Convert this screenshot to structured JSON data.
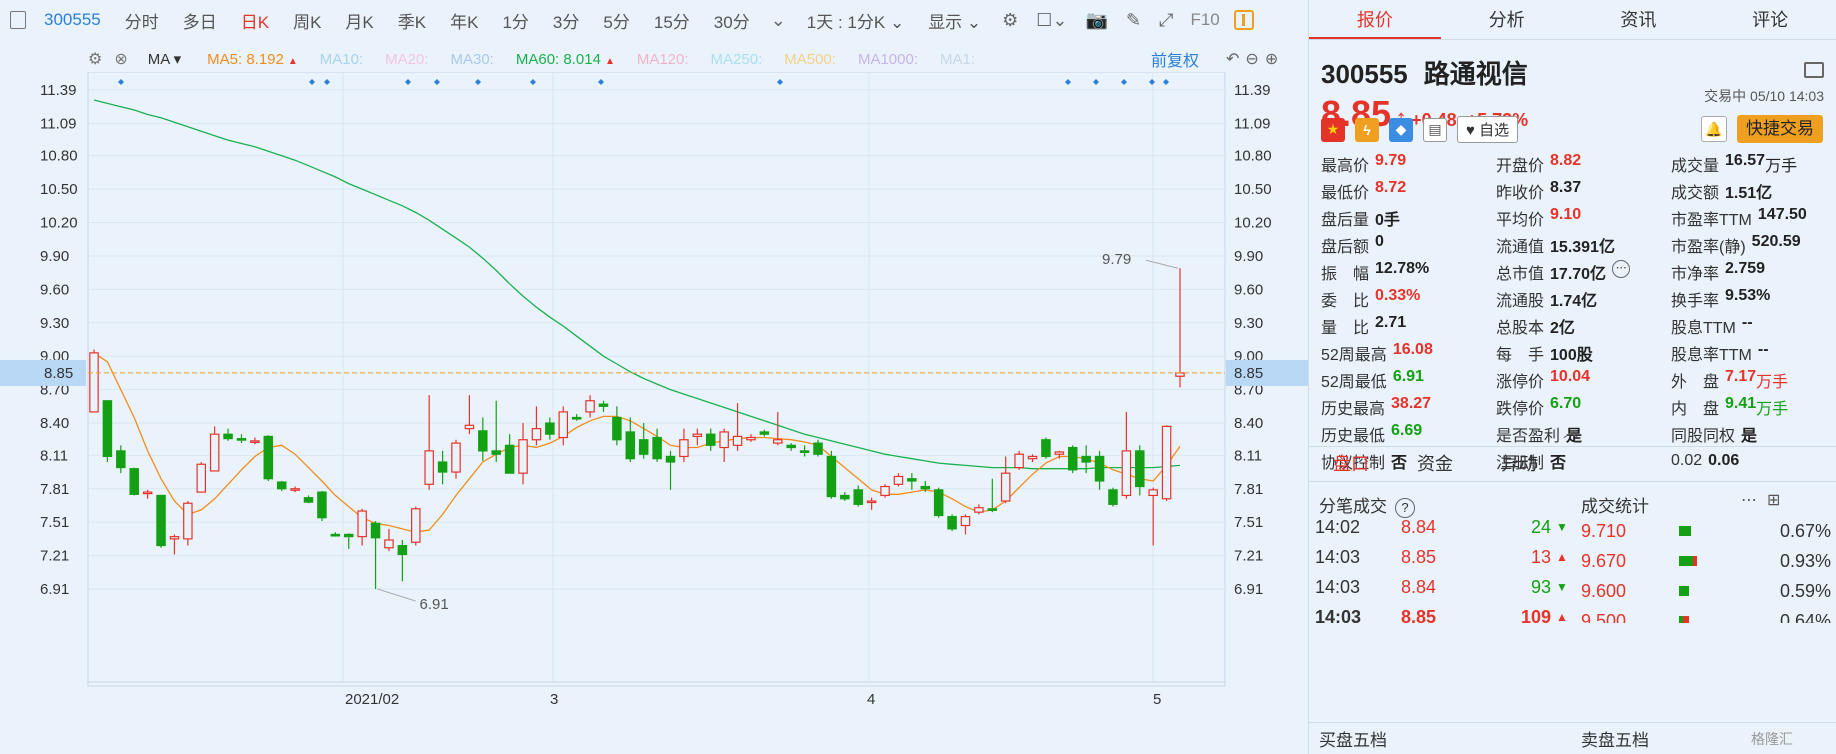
{
  "toolbar": {
    "code": "300555",
    "items": [
      "分时",
      "多日",
      "日K",
      "周K",
      "月K",
      "季K",
      "年K",
      "1分",
      "3分",
      "5分",
      "15分",
      "30分"
    ],
    "active": "日K",
    "period_select": "1天 : 1分K",
    "display_select": "显示",
    "f10": "F10"
  },
  "ma_bar": {
    "indicator": "MA",
    "items": [
      {
        "label": "MA5:",
        "value": "8.192",
        "color": "#f08c1e",
        "arrow": "up"
      },
      {
        "label": "MA10:",
        "value": "",
        "color": "#a8d4f0"
      },
      {
        "label": "MA20:",
        "value": "",
        "color": "#f2c6e0"
      },
      {
        "label": "MA30:",
        "value": "",
        "color": "#a8c8f0"
      },
      {
        "label": "MA60:",
        "value": "8.014",
        "color": "#1ab04e",
        "arrow": "up"
      },
      {
        "label": "MA120:",
        "value": "",
        "color": "#f0b4c8"
      },
      {
        "label": "MA250:",
        "value": "",
        "color": "#a8e0f0"
      },
      {
        "label": "MA500:",
        "value": "",
        "color": "#f5d08a"
      },
      {
        "label": "MA1000:",
        "value": "",
        "color": "#c8b4e8"
      },
      {
        "label": "MA1:",
        "value": "",
        "color": "#c8d8e8"
      }
    ],
    "fuquan": "前复权"
  },
  "chart_data": {
    "type": "candlestick",
    "y_ticks": [
      "11.39",
      "11.09",
      "10.80",
      "10.50",
      "10.20",
      "9.90",
      "9.60",
      "9.30",
      "9.00",
      "8.70",
      "8.40",
      "8.11",
      "7.81",
      "7.51",
      "7.21",
      "6.91"
    ],
    "ylim": [
      6.91,
      11.39
    ],
    "x_labels": [
      "2021/02",
      "3",
      "4",
      "5"
    ],
    "current_price": "8.85",
    "high_marker": "9.79",
    "low_marker": "6.91",
    "colors": {
      "up": "#e6332a",
      "down": "#14a014",
      "ma5": "#f08c1e",
      "ma60": "#1ab04e"
    },
    "candles": [
      {
        "o": 8.5,
        "h": 9.06,
        "l": 8.5,
        "c": 9.03
      },
      {
        "o": 8.6,
        "h": 8.6,
        "l": 8.05,
        "c": 8.1
      },
      {
        "o": 8.15,
        "h": 8.2,
        "l": 7.95,
        "c": 8.0
      },
      {
        "o": 7.99,
        "h": 8.0,
        "l": 7.75,
        "c": 7.76
      },
      {
        "o": 7.77,
        "h": 7.8,
        "l": 7.72,
        "c": 7.78
      },
      {
        "o": 7.75,
        "h": 7.75,
        "l": 7.28,
        "c": 7.3
      },
      {
        "o": 7.36,
        "h": 7.4,
        "l": 7.22,
        "c": 7.38
      },
      {
        "o": 7.36,
        "h": 7.7,
        "l": 7.3,
        "c": 7.68
      },
      {
        "o": 7.78,
        "h": 8.05,
        "l": 7.78,
        "c": 8.03
      },
      {
        "o": 7.97,
        "h": 8.37,
        "l": 7.97,
        "c": 8.3
      },
      {
        "o": 8.3,
        "h": 8.35,
        "l": 8.24,
        "c": 8.26
      },
      {
        "o": 8.26,
        "h": 8.3,
        "l": 8.22,
        "c": 8.25
      },
      {
        "o": 8.24,
        "h": 8.27,
        "l": 8.21,
        "c": 8.24
      },
      {
        "o": 8.28,
        "h": 8.29,
        "l": 7.88,
        "c": 7.9
      },
      {
        "o": 7.87,
        "h": 7.88,
        "l": 7.79,
        "c": 7.81
      },
      {
        "o": 7.8,
        "h": 7.83,
        "l": 7.78,
        "c": 7.81
      },
      {
        "o": 7.73,
        "h": 7.75,
        "l": 7.68,
        "c": 7.69
      },
      {
        "o": 7.78,
        "h": 7.79,
        "l": 7.52,
        "c": 7.55
      },
      {
        "o": 7.4,
        "h": 7.42,
        "l": 7.38,
        "c": 7.39
      },
      {
        "o": 7.4,
        "h": 7.41,
        "l": 7.27,
        "c": 7.38
      },
      {
        "o": 7.38,
        "h": 7.63,
        "l": 7.3,
        "c": 7.61
      },
      {
        "o": 7.5,
        "h": 7.52,
        "l": 6.91,
        "c": 7.37
      },
      {
        "o": 7.28,
        "h": 7.45,
        "l": 7.25,
        "c": 7.35
      },
      {
        "o": 7.3,
        "h": 7.35,
        "l": 6.98,
        "c": 7.22
      },
      {
        "o": 7.33,
        "h": 7.65,
        "l": 7.3,
        "c": 7.63
      },
      {
        "o": 7.85,
        "h": 8.65,
        "l": 7.8,
        "c": 8.15
      },
      {
        "o": 8.05,
        "h": 8.15,
        "l": 7.85,
        "c": 7.96
      },
      {
        "o": 7.96,
        "h": 8.25,
        "l": 7.9,
        "c": 8.22
      },
      {
        "o": 8.35,
        "h": 8.65,
        "l": 8.3,
        "c": 8.38
      },
      {
        "o": 8.33,
        "h": 8.45,
        "l": 8.06,
        "c": 8.15
      },
      {
        "o": 8.15,
        "h": 8.6,
        "l": 8.05,
        "c": 8.12
      },
      {
        "o": 8.2,
        "h": 8.3,
        "l": 7.95,
        "c": 7.95
      },
      {
        "o": 7.95,
        "h": 8.4,
        "l": 7.85,
        "c": 8.25
      },
      {
        "o": 8.25,
        "h": 8.55,
        "l": 8.2,
        "c": 8.35
      },
      {
        "o": 8.4,
        "h": 8.45,
        "l": 8.25,
        "c": 8.3
      },
      {
        "o": 8.27,
        "h": 8.55,
        "l": 8.2,
        "c": 8.5
      },
      {
        "o": 8.45,
        "h": 8.48,
        "l": 8.42,
        "c": 8.44
      },
      {
        "o": 8.5,
        "h": 8.65,
        "l": 8.45,
        "c": 8.6
      },
      {
        "o": 8.57,
        "h": 8.6,
        "l": 8.5,
        "c": 8.55
      },
      {
        "o": 8.45,
        "h": 8.55,
        "l": 8.2,
        "c": 8.25
      },
      {
        "o": 8.32,
        "h": 8.45,
        "l": 8.05,
        "c": 8.08
      },
      {
        "o": 8.25,
        "h": 8.4,
        "l": 8.08,
        "c": 8.12
      },
      {
        "o": 8.27,
        "h": 8.35,
        "l": 8.05,
        "c": 8.08
      },
      {
        "o": 8.1,
        "h": 8.15,
        "l": 7.8,
        "c": 8.05
      },
      {
        "o": 8.1,
        "h": 8.35,
        "l": 8.05,
        "c": 8.25
      },
      {
        "o": 8.28,
        "h": 8.35,
        "l": 8.2,
        "c": 8.3
      },
      {
        "o": 8.3,
        "h": 8.35,
        "l": 8.15,
        "c": 8.2
      },
      {
        "o": 8.18,
        "h": 8.35,
        "l": 8.05,
        "c": 8.32
      },
      {
        "o": 8.2,
        "h": 8.58,
        "l": 8.15,
        "c": 8.28
      },
      {
        "o": 8.25,
        "h": 8.3,
        "l": 8.23,
        "c": 8.27
      },
      {
        "o": 8.32,
        "h": 8.34,
        "l": 8.28,
        "c": 8.3
      },
      {
        "o": 8.22,
        "h": 8.5,
        "l": 8.2,
        "c": 8.25
      },
      {
        "o": 8.2,
        "h": 8.22,
        "l": 8.15,
        "c": 8.18
      },
      {
        "o": 8.15,
        "h": 8.2,
        "l": 8.1,
        "c": 8.14
      },
      {
        "o": 8.22,
        "h": 8.25,
        "l": 8.1,
        "c": 8.12
      },
      {
        "o": 8.1,
        "h": 8.15,
        "l": 7.72,
        "c": 7.74
      },
      {
        "o": 7.75,
        "h": 7.78,
        "l": 7.7,
        "c": 7.72
      },
      {
        "o": 7.8,
        "h": 7.84,
        "l": 7.65,
        "c": 7.67
      },
      {
        "o": 7.7,
        "h": 7.73,
        "l": 7.62,
        "c": 7.7
      },
      {
        "o": 7.75,
        "h": 7.85,
        "l": 7.73,
        "c": 7.83
      },
      {
        "o": 7.85,
        "h": 7.95,
        "l": 7.83,
        "c": 7.92
      },
      {
        "o": 7.9,
        "h": 7.95,
        "l": 7.8,
        "c": 7.88
      },
      {
        "o": 7.83,
        "h": 7.88,
        "l": 7.78,
        "c": 7.81
      },
      {
        "o": 7.8,
        "h": 7.82,
        "l": 7.55,
        "c": 7.57
      },
      {
        "o": 7.56,
        "h": 7.58,
        "l": 7.43,
        "c": 7.45
      },
      {
        "o": 7.48,
        "h": 7.58,
        "l": 7.4,
        "c": 7.56
      },
      {
        "o": 7.6,
        "h": 7.67,
        "l": 7.58,
        "c": 7.64
      },
      {
        "o": 7.63,
        "h": 7.9,
        "l": 7.6,
        "c": 7.62
      },
      {
        "o": 7.7,
        "h": 8.1,
        "l": 7.68,
        "c": 7.95
      },
      {
        "o": 8.0,
        "h": 8.15,
        "l": 7.98,
        "c": 8.12
      },
      {
        "o": 8.08,
        "h": 8.12,
        "l": 8.05,
        "c": 8.1
      },
      {
        "o": 8.25,
        "h": 8.27,
        "l": 8.08,
        "c": 8.1
      },
      {
        "o": 8.12,
        "h": 8.15,
        "l": 8.08,
        "c": 8.14
      },
      {
        "o": 8.18,
        "h": 8.2,
        "l": 7.95,
        "c": 7.98
      },
      {
        "o": 8.1,
        "h": 8.2,
        "l": 7.95,
        "c": 8.05
      },
      {
        "o": 8.1,
        "h": 8.15,
        "l": 7.8,
        "c": 7.88
      },
      {
        "o": 7.8,
        "h": 7.82,
        "l": 7.65,
        "c": 7.67
      },
      {
        "o": 7.75,
        "h": 8.5,
        "l": 7.72,
        "c": 8.15
      },
      {
        "o": 8.15,
        "h": 8.2,
        "l": 7.75,
        "c": 7.83
      },
      {
        "o": 7.75,
        "h": 7.82,
        "l": 7.3,
        "c": 7.8
      },
      {
        "o": 7.72,
        "h": 8.38,
        "l": 7.7,
        "c": 8.37
      },
      {
        "o": 8.82,
        "h": 9.79,
        "l": 8.72,
        "c": 8.85
      }
    ],
    "ma5": [
      9.03,
      8.95,
      8.7,
      8.45,
      8.15,
      7.9,
      7.7,
      7.58,
      7.62,
      7.72,
      7.85,
      7.98,
      8.1,
      8.18,
      8.2,
      8.12,
      8.0,
      7.88,
      7.75,
      7.65,
      7.55,
      7.5,
      7.48,
      7.45,
      7.42,
      7.44,
      7.58,
      7.75,
      7.9,
      8.05,
      8.12,
      8.18,
      8.2,
      8.18,
      8.22,
      8.28,
      8.36,
      8.42,
      8.46,
      8.46,
      8.42,
      8.35,
      8.28,
      8.2,
      8.18,
      8.18,
      8.22,
      8.24,
      8.26,
      8.27,
      8.27,
      8.26,
      8.25,
      8.23,
      8.2,
      8.1,
      8.0,
      7.9,
      7.8,
      7.76,
      7.76,
      7.78,
      7.8,
      7.78,
      7.72,
      7.65,
      7.6,
      7.62,
      7.7,
      7.82,
      7.94,
      8.04,
      8.1,
      8.1,
      8.08,
      8.04,
      7.98,
      7.94,
      7.9,
      7.88,
      8.02,
      8.19
    ],
    "ma60": [
      11.3,
      11.27,
      11.24,
      11.21,
      11.17,
      11.14,
      11.1,
      11.06,
      11.02,
      10.98,
      10.94,
      10.91,
      10.88,
      10.84,
      10.8,
      10.76,
      10.71,
      10.66,
      10.61,
      10.55,
      10.5,
      10.45,
      10.4,
      10.35,
      10.29,
      10.22,
      10.14,
      10.06,
      9.98,
      9.88,
      9.77,
      9.65,
      9.54,
      9.44,
      9.35,
      9.27,
      9.18,
      9.09,
      9.0,
      8.93,
      8.86,
      8.8,
      8.75,
      8.7,
      8.66,
      8.62,
      8.58,
      8.54,
      8.5,
      8.46,
      8.42,
      8.38,
      8.34,
      8.3,
      8.27,
      8.24,
      8.21,
      8.18,
      8.15,
      8.12,
      8.1,
      8.08,
      8.06,
      8.04,
      8.03,
      8.02,
      8.01,
      8.0,
      8.0,
      8.0,
      7.99,
      7.99,
      7.99,
      7.99,
      7.99,
      8.0,
      8.0,
      8.0,
      8.0,
      8.0,
      8.01,
      8.02
    ]
  },
  "panel": {
    "tabs": [
      "报价",
      "分析",
      "资讯",
      "评论"
    ],
    "active_tab": "报价",
    "code": "300555",
    "name": "路通视信",
    "price": "8.85",
    "change": "+0.48",
    "change_pct": "+5.73%",
    "status": "交易中 05/10 14:03",
    "watch": "自选",
    "quick_trade": "快捷交易",
    "quote": [
      [
        {
          "label": "最高价",
          "value": "9.79",
          "color": "red"
        },
        {
          "label": "开盘价",
          "value": "8.82",
          "color": "red"
        },
        {
          "label": "成交量",
          "value": "16.57",
          "unit": "万手",
          "color": "black"
        }
      ],
      [
        {
          "label": "最低价",
          "value": "8.72",
          "color": "red"
        },
        {
          "label": "昨收价",
          "value": "8.37",
          "color": "black"
        },
        {
          "label": "成交额",
          "value": "1.51亿",
          "color": "black"
        }
      ],
      [
        {
          "label": "盘后量",
          "value": "0手",
          "color": "black"
        },
        {
          "label": "平均价",
          "value": "9.10",
          "color": "red"
        },
        {
          "label": "市盈率TTM",
          "value": "147.50",
          "color": "black"
        }
      ],
      [
        {
          "label": "盘后额",
          "value": "0",
          "color": "black"
        },
        {
          "label": "流通值",
          "value": "15.391亿",
          "color": "black"
        },
        {
          "label": "市盈率(静)",
          "value": "520.59",
          "color": "black"
        }
      ],
      [
        {
          "label": "振　幅",
          "value": "12.78%",
          "color": "black"
        },
        {
          "label": "总市值",
          "value": "17.70亿",
          "color": "black",
          "more": true
        },
        {
          "label": "市净率",
          "value": "2.759",
          "color": "black"
        }
      ],
      [
        {
          "label": "委　比",
          "value": "0.33%",
          "color": "red"
        },
        {
          "label": "流通股",
          "value": "1.74亿",
          "color": "black"
        },
        {
          "label": "换手率",
          "value": "9.53%",
          "color": "black"
        }
      ],
      [
        {
          "label": "量　比",
          "value": "2.71",
          "color": "black"
        },
        {
          "label": "总股本",
          "value": "2亿",
          "color": "black"
        },
        {
          "label": "股息TTM",
          "value": "--",
          "color": "black"
        }
      ],
      [
        {
          "label": "52周最高",
          "value": "16.08",
          "color": "red"
        },
        {
          "label": "每　手",
          "value": "100股",
          "color": "black"
        },
        {
          "label": "股息率TTM",
          "value": "--",
          "color": "black"
        }
      ],
      [
        {
          "label": "52周最低",
          "value": "6.91",
          "color": "green"
        },
        {
          "label": "涨停价",
          "value": "10.04",
          "color": "red"
        },
        {
          "label": "外　盘",
          "value": "7.17",
          "unit": "万手",
          "color": "red"
        }
      ],
      [
        {
          "label": "历史最高",
          "value": "38.27",
          "color": "red"
        },
        {
          "label": "跌停价",
          "value": "6.70",
          "color": "green"
        },
        {
          "label": "内　盘",
          "value": "9.41",
          "unit": "万手",
          "color": "green"
        }
      ],
      [
        {
          "label": "历史最低",
          "value": "6.69",
          "color": "green"
        },
        {
          "label": "是否盈利",
          "value": "是",
          "color": "black"
        },
        {
          "label": "同股同权",
          "value": "是",
          "color": "black"
        }
      ],
      [
        {
          "label": "协议控制",
          "value": "否",
          "color": "black"
        },
        {
          "label": "注册制",
          "value": "否",
          "color": "black"
        },
        {
          "label": "0.02",
          "value": "0.06",
          "color": "black"
        }
      ]
    ],
    "sub_tabs": [
      "盘口",
      "资金",
      "异动"
    ],
    "active_sub_tab": "盘口",
    "trades_title": "分笔成交",
    "stats_title": "成交统计",
    "trades": [
      {
        "time": "14:02",
        "price": "8.84",
        "vol": "24",
        "dir": "down"
      },
      {
        "time": "14:03",
        "price": "8.85",
        "vol": "13",
        "dir": "up"
      },
      {
        "time": "14:03",
        "price": "8.84",
        "vol": "93",
        "dir": "down"
      },
      {
        "time": "14:03",
        "price": "8.85",
        "vol": "109",
        "dir": "up"
      }
    ],
    "stats": [
      {
        "price": "9.710",
        "pct": "0.67%",
        "green": 0.3,
        "red": 0.0
      },
      {
        "price": "9.670",
        "pct": "0.93%",
        "green": 0.35,
        "red": 0.1
      },
      {
        "price": "9.600",
        "pct": "0.59%",
        "green": 0.25,
        "red": 0.0
      },
      {
        "price": "9.500",
        "pct": "0.64%",
        "green": 0.1,
        "red": 0.15
      }
    ],
    "buy_book": "买盘五档",
    "sell_book": "卖盘五档",
    "watermark": "格隆汇"
  }
}
